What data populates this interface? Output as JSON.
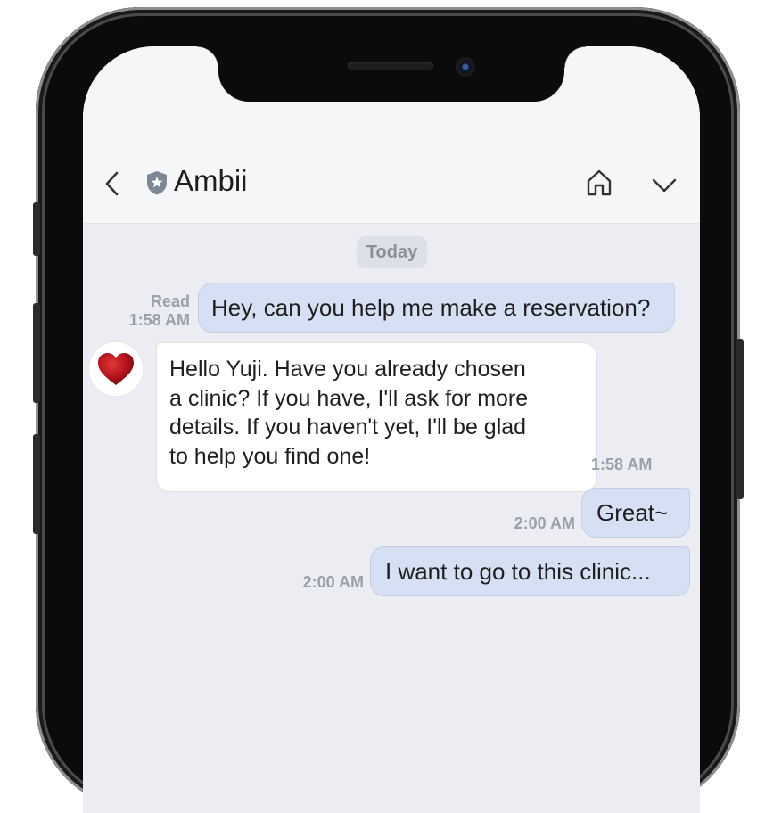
{
  "app": {
    "title": "Ambii"
  },
  "header": {
    "back_icon": "chevron-left-icon",
    "shield_icon": "shield-star-icon",
    "home_icon": "home-icon",
    "menu_icon": "chevron-down-icon"
  },
  "chat": {
    "date_divider": "Today",
    "messages": [
      {
        "from": "user",
        "read_status": "Read",
        "time": "1:58 AM",
        "text": "Hey, can you help me make a reservation?"
      },
      {
        "from": "bot",
        "time": "1:58 AM",
        "lines": [
          "Hello Yuji. Have you already chosen",
          "a clinic? If you have, I'll ask for more",
          "details. If you haven't yet, I'll be glad",
          "to help you find one!"
        ]
      },
      {
        "from": "user",
        "time": "2:00 AM",
        "text": "Great~"
      },
      {
        "from": "user",
        "time": "2:00 AM",
        "text": "I want to go to this clinic..."
      }
    ]
  },
  "colors": {
    "outgoing_bubble": "#d6e0f4",
    "incoming_bubble": "#ffffff",
    "chat_background": "#ebedf2",
    "avatar_heart": "#b3111a"
  }
}
